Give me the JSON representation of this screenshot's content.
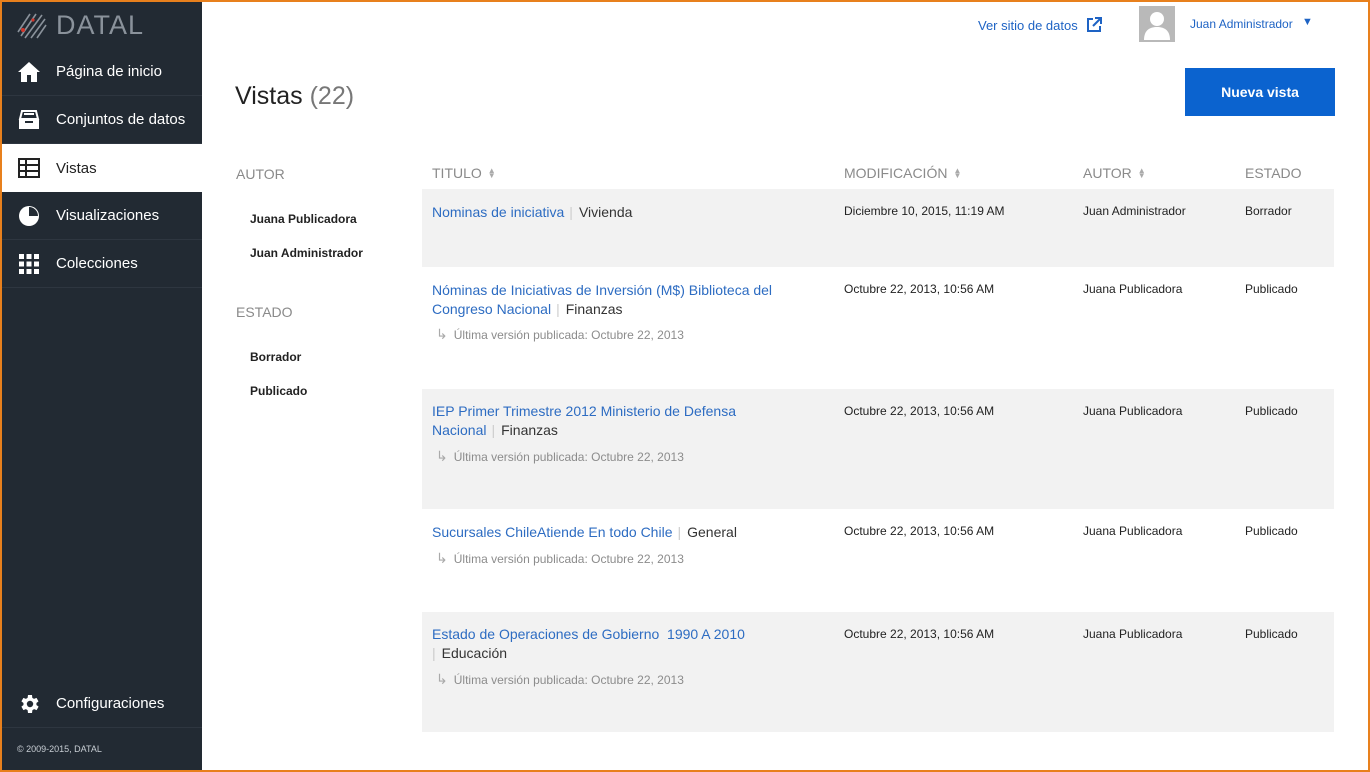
{
  "brand": {
    "name": "DATAL"
  },
  "sidebar": {
    "items": [
      {
        "label": "Página de inicio",
        "icon": "home-icon"
      },
      {
        "label": "Conjuntos de datos",
        "icon": "datasets-icon"
      },
      {
        "label": "Vistas",
        "icon": "table-icon",
        "active": true
      },
      {
        "label": "Visualizaciones",
        "icon": "pie-chart-icon"
      },
      {
        "label": "Colecciones",
        "icon": "grid-icon"
      }
    ],
    "settings_label": "Configuraciones",
    "copyright": "© 2009-2015, DATAL"
  },
  "header": {
    "site_link": "Ver sitio de datos",
    "user_name": "Juan Administrador",
    "caret": "▼"
  },
  "page": {
    "title": "Vistas",
    "count": "(22)",
    "new_button": "Nueva vista"
  },
  "filters": {
    "author_heading": "AUTOR",
    "authors": [
      "Juana Publicadora",
      "Juan Administrador"
    ],
    "state_heading": "ESTADO",
    "states": [
      "Borrador",
      "Publicado"
    ]
  },
  "table": {
    "columns": [
      "TITULO",
      "MODIFICACIÓN",
      "AUTOR",
      "ESTADO"
    ],
    "rows": [
      {
        "title": "Nominas de iniciativa",
        "category": "Vivienda",
        "version": "",
        "modified": "Diciembre 10, 2015, 11:19 AM",
        "author": "Juan Administrador",
        "state": "Borrador"
      },
      {
        "title": "Nóminas de Iniciativas de Inversión (M$) Biblioteca del Congreso Nacional",
        "category": "Finanzas",
        "version": "Última versión publicada: Octubre 22, 2013",
        "modified": "Octubre 22, 2013, 10:56 AM",
        "author": "Juana Publicadora",
        "state": "Publicado"
      },
      {
        "title": "IEP Primer Trimestre 2012 Ministerio de Defensa Nacional",
        "category": "Finanzas",
        "version": "Última versión publicada: Octubre 22, 2013",
        "modified": "Octubre 22, 2013, 10:56 AM",
        "author": "Juana Publicadora",
        "state": "Publicado"
      },
      {
        "title": "Sucursales ChileAtiende En todo Chile",
        "category": "General",
        "version": "Última versión publicada: Octubre 22, 2013",
        "modified": "Octubre 22, 2013, 10:56 AM",
        "author": "Juana Publicadora",
        "state": "Publicado"
      },
      {
        "title": "Estado de Operaciones de Gobierno  1990 A 2010",
        "category": "Educación",
        "version": "Última versión publicada: Octubre 22, 2013",
        "modified": "Octubre 22, 2013, 10:56 AM",
        "author": "Juana Publicadora",
        "state": "Publicado"
      }
    ]
  },
  "colors": {
    "accent": "#0b63cf",
    "link": "#2d6cc2",
    "sidebar": "#222a33",
    "frame": "#e8801d"
  }
}
